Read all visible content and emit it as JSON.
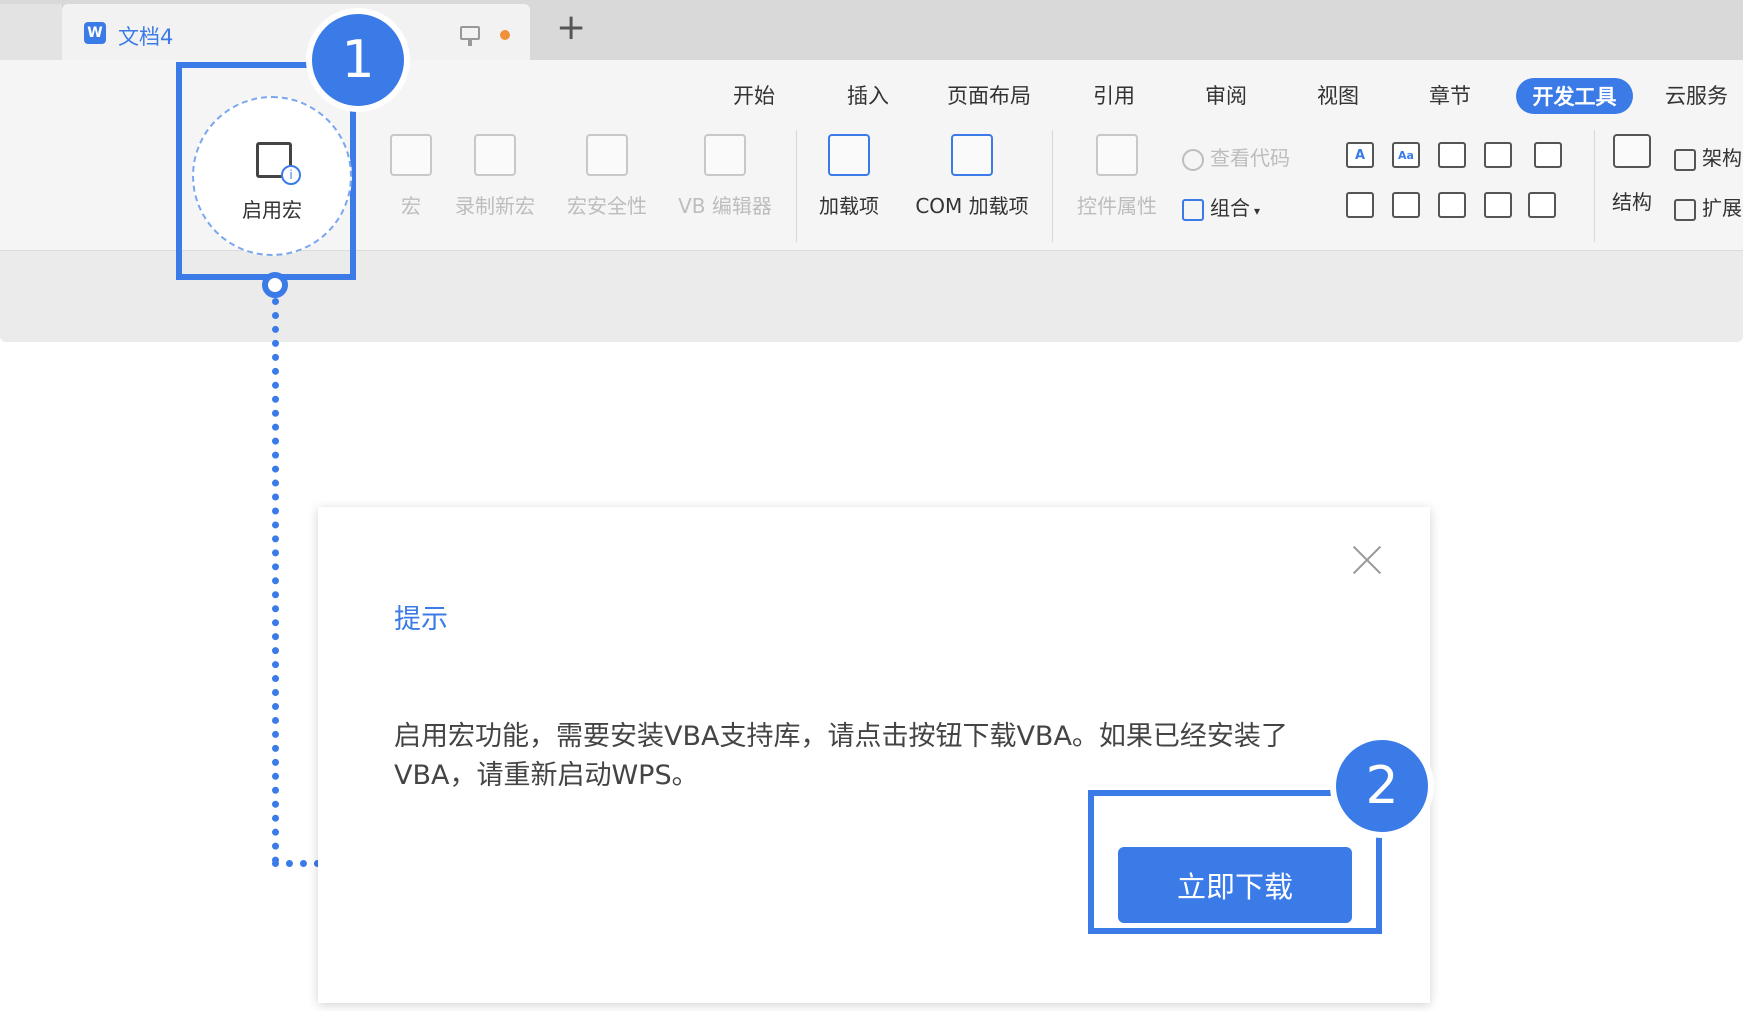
{
  "tabbar": {
    "doc_tab_title": "文档4",
    "word_icon_letter": "W",
    "new_tab": "+"
  },
  "menu": {
    "items": [
      "开始",
      "插入",
      "页面布局",
      "引用",
      "审阅",
      "视图",
      "章节",
      "开发工具",
      "云服务"
    ],
    "active": "开发工具"
  },
  "ribbon": {
    "enable_macro": "启用宏",
    "tools_disabled": [
      "宏",
      "录制新宏",
      "宏安全性",
      "VB 编辑器"
    ],
    "tools_enabled": [
      "加载项",
      "COM 加载项"
    ],
    "control_props": "控件属性",
    "view_code": "查看代码",
    "group": "组合",
    "structure": "结构",
    "framework": "架构",
    "extend": "扩展",
    "textbox_icon_letter": "A",
    "richtext_icon_letters": "Aa"
  },
  "annotations": {
    "step1": "1",
    "step2": "2",
    "accent_color": "#3b7be8"
  },
  "dialog": {
    "title": "提示",
    "message": "启用宏功能，需要安装VBA支持库，请点击按钮下载VBA。如果已经安装了VBA，请重新启动WPS。",
    "button": "立即下载",
    "close_icon": "close-icon"
  }
}
